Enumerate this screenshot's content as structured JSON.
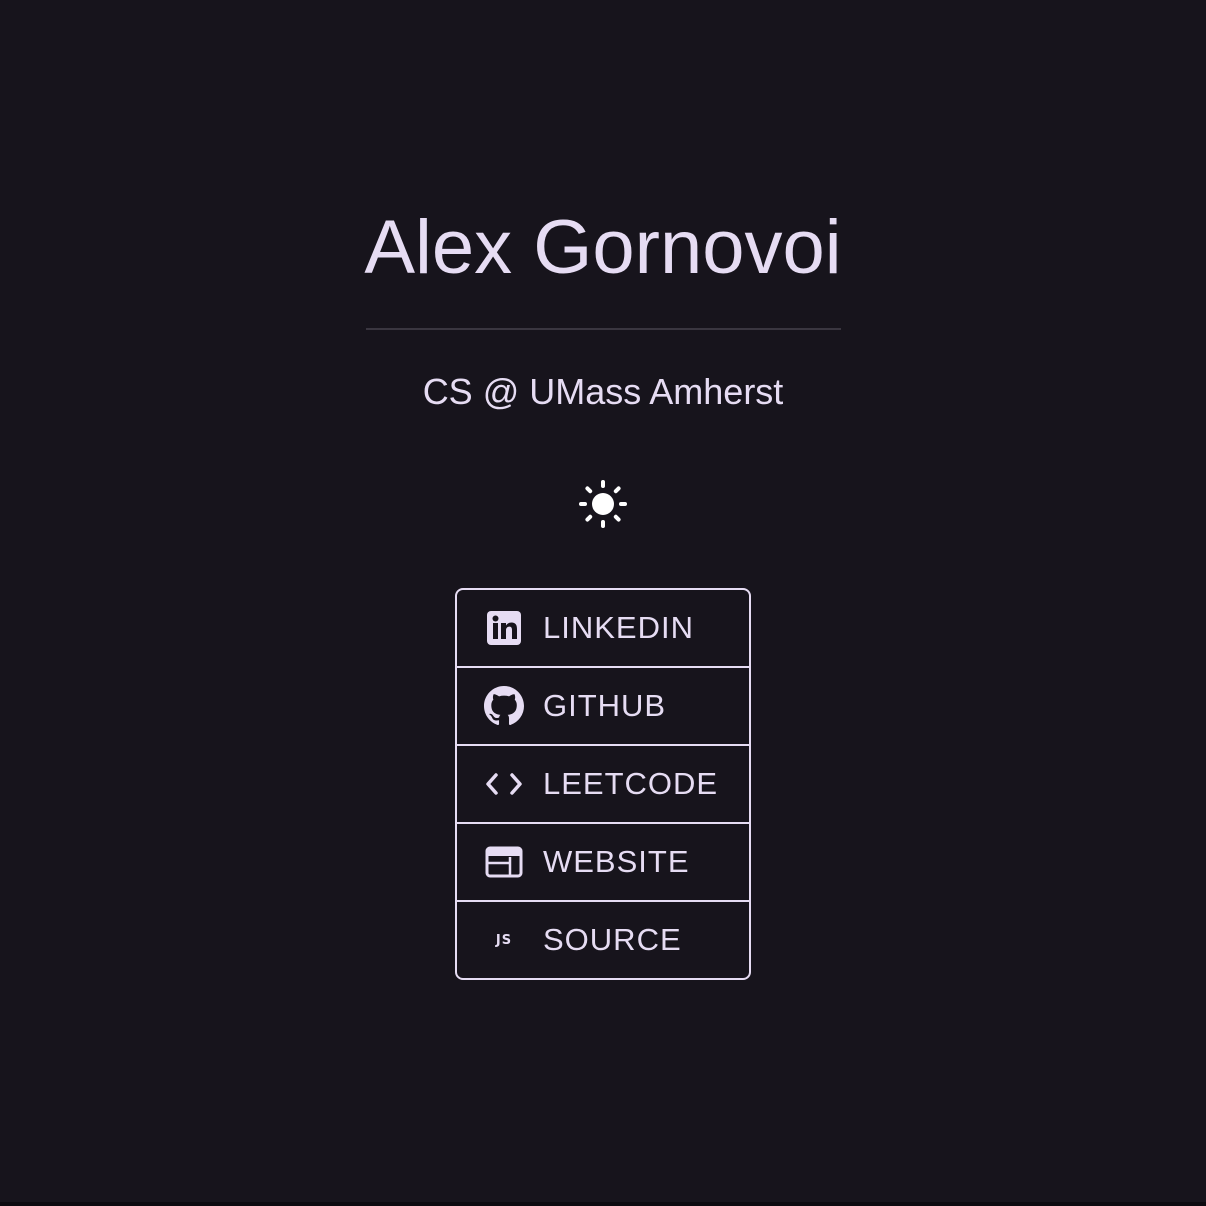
{
  "header": {
    "name": "Alex Gornovoi",
    "tagline": "CS @ UMass Amherst"
  },
  "theme_toggle": {
    "icon": "sun-icon"
  },
  "links": [
    {
      "label": "LINKEDIN",
      "icon": "linkedin-icon"
    },
    {
      "label": "GITHUB",
      "icon": "github-icon"
    },
    {
      "label": "LEETCODE",
      "icon": "code-icon"
    },
    {
      "label": "WEBSITE",
      "icon": "browser-window-icon"
    },
    {
      "label": "SOURCE",
      "icon": "js-icon",
      "badge": "JS"
    }
  ],
  "colors": {
    "background": "#17141c",
    "text": "#e6dcf3",
    "divider": "#3a3640",
    "icon_white": "#ffffff"
  }
}
